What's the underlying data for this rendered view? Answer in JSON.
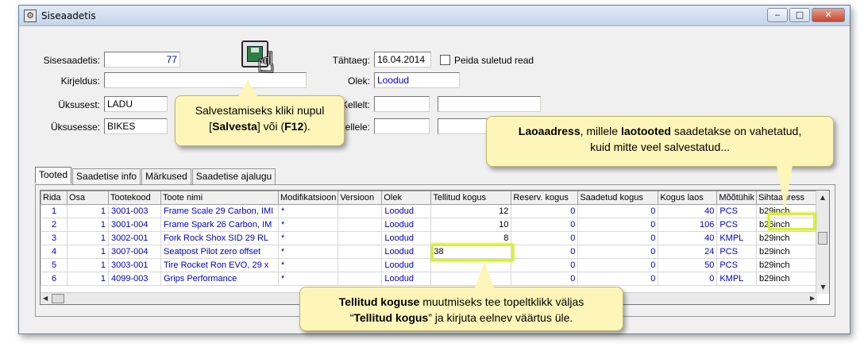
{
  "window": {
    "title": "Siseaadetis",
    "min": "‒",
    "max": "□",
    "close": "✕"
  },
  "form": {
    "sisesaadetis_label": "Sisesaadetis:",
    "sisesaadetis_value": "77",
    "kirjeldus_label": "Kirjeldus:",
    "kirjeldus_value": "",
    "uksusest_label": "Üksusest:",
    "uksusest_value": "LADU",
    "uksusesse_label": "Üksusesse:",
    "uksusesse_value": "BIKES",
    "tahtaeg_label": "Tähtaeg:",
    "tahtaeg_value": "16.04.2014",
    "peida_label": "Peida suletud read",
    "olek_label": "Olek:",
    "olek_value": "Loodud",
    "kellelt_label": "Kellelt:",
    "kellele_label": "Kellele:"
  },
  "tabs": [
    "Tooted",
    "Saadetise info",
    "Märkused",
    "Saadetise ajalugu"
  ],
  "table": {
    "headers": [
      "Rida",
      "Osa",
      "Tootekood",
      "Toote nimi",
      "Modifikatsioon",
      "Versioon",
      "Olek",
      "Tellitud kogus",
      "Reserv. kogus",
      "Saadetud kogus",
      "Kogus laos",
      "Mõõtühik",
      "Sihtaadress"
    ],
    "rows": [
      {
        "rida": "1",
        "osa": "1",
        "kood": "3001-003",
        "nimi": "Frame Scale 29 Carbon, IMI",
        "mod": "*",
        "ver": "",
        "olek": "Loodud",
        "tellitud": "12",
        "reserv": "0",
        "saadetud": "0",
        "laos": "40",
        "yhik": "PCS",
        "siht": "b29inch"
      },
      {
        "rida": "2",
        "osa": "1",
        "kood": "3001-004",
        "nimi": "Frame Spark 26 Carbon, IM",
        "mod": "*",
        "ver": "",
        "olek": "Loodud",
        "tellitud": "10",
        "reserv": "0",
        "saadetud": "0",
        "laos": "106",
        "yhik": "PCS",
        "siht": "b26inch"
      },
      {
        "rida": "3",
        "osa": "1",
        "kood": "3002-001",
        "nimi": "Fork Rock Shox SID 29 RL",
        "mod": "*",
        "ver": "",
        "olek": "Loodud",
        "tellitud": "8",
        "reserv": "0",
        "saadetud": "0",
        "laos": "40",
        "yhik": "KMPL",
        "siht": "b29inch"
      },
      {
        "rida": "4",
        "osa": "1",
        "kood": "3007-004",
        "nimi": "Seatpost Pilot zero offset",
        "mod": "*",
        "ver": "",
        "olek": "Loodud",
        "tellitud": "38",
        "reserv": "0",
        "saadetud": "0",
        "laos": "24",
        "yhik": "PCS",
        "siht": "b29inch"
      },
      {
        "rida": "5",
        "osa": "1",
        "kood": "3003-001",
        "nimi": "Tire Rocket Ron EVO, 29 x",
        "mod": "*",
        "ver": "",
        "olek": "Loodud",
        "tellitud": "",
        "reserv": "0",
        "saadetud": "0",
        "laos": "50",
        "yhik": "PCS",
        "siht": "b29inch"
      },
      {
        "rida": "6",
        "osa": "1",
        "kood": "4099-003",
        "nimi": "Grips Performance",
        "mod": "*",
        "ver": "",
        "olek": "Loodud",
        "tellitud": "",
        "reserv": "0",
        "saadetud": "0",
        "laos": "0",
        "yhik": "KMPL",
        "siht": "b29inch"
      }
    ]
  },
  "callouts": {
    "save_1": "Salvestamiseks kliki nupul",
    "save_2a": "[",
    "save_2b": "Salvesta",
    "save_2c": "] või (",
    "save_2d": "F12",
    "save_2e": ").",
    "addr_bold1": "Laoaadress",
    "addr_mid": ", millele ",
    "addr_bold2": "laotooted",
    "addr_rest": " saadetakse on vahetatud,",
    "addr_line2": "kuid mitte veel salvestatud...",
    "qty_bold": "Tellitud koguse",
    "qty_rest": " muutmiseks tee topeltklikk väljas",
    "qty_q1": "“",
    "qty_bold2": "Tellitud kogus",
    "qty_q2": "” ja kirjuta eelnev väärtus üle."
  }
}
